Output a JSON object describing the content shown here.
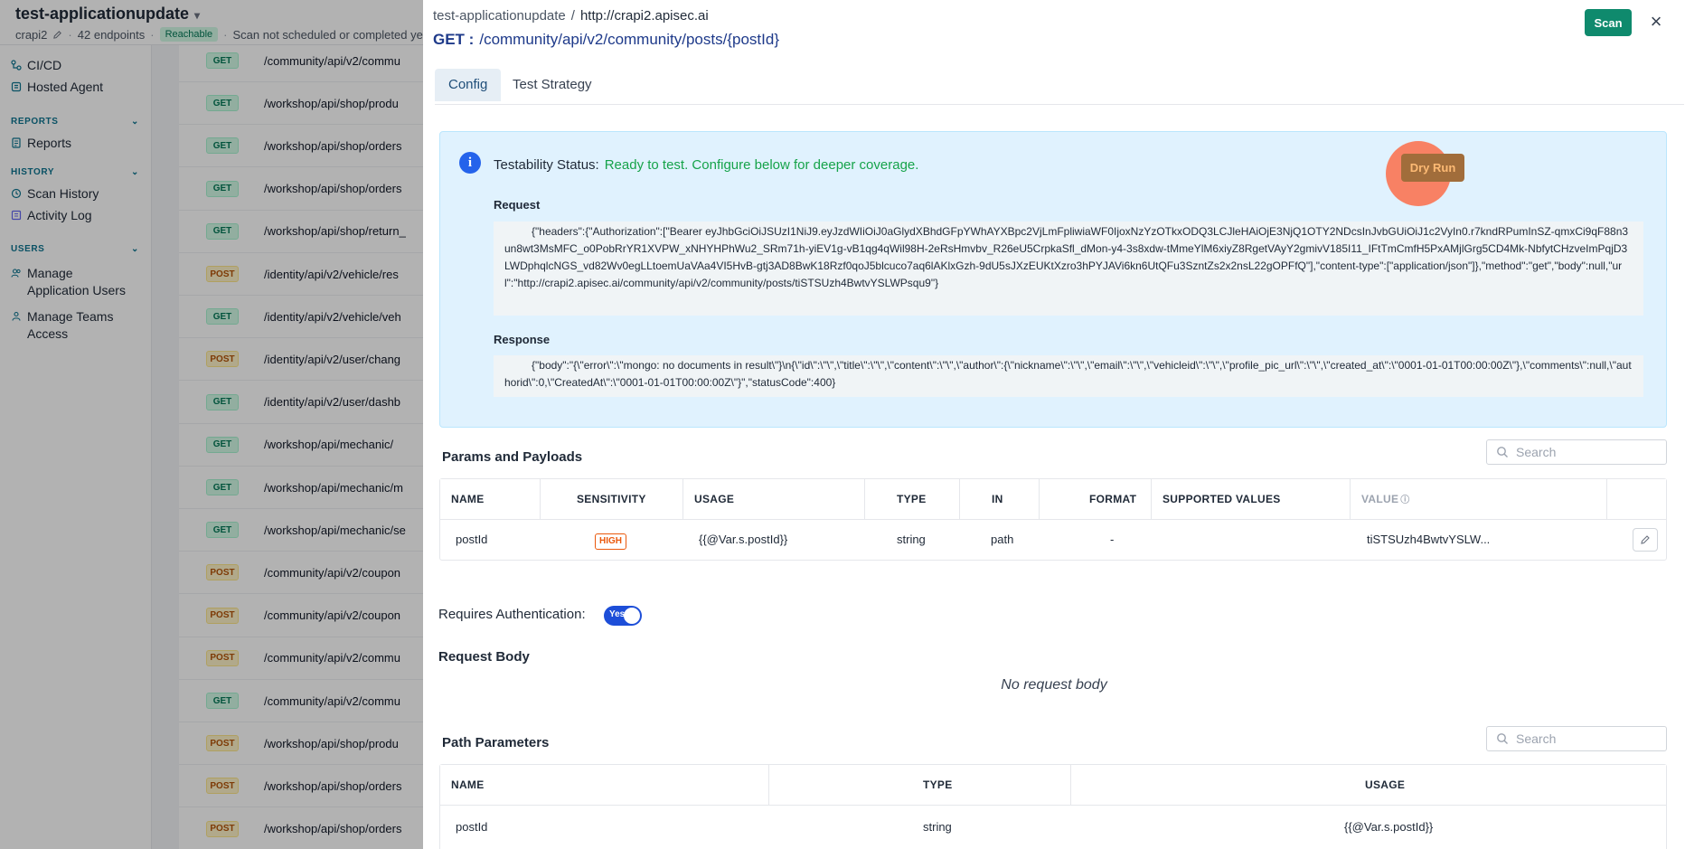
{
  "app": {
    "title": "test-applicationupdate",
    "project": "crapi2",
    "endpoints": "42 endpoints",
    "reachable": "Reachable",
    "scan_status": "Scan not scheduled or completed yet"
  },
  "sidebar": {
    "items": [
      {
        "label": "CI/CD",
        "icon": "cicd-icon"
      },
      {
        "label": "Hosted Agent",
        "icon": "agent-icon"
      }
    ],
    "sections": [
      {
        "label": "REPORTS",
        "items": [
          {
            "label": "Reports",
            "icon": "report-icon"
          }
        ]
      },
      {
        "label": "HISTORY",
        "items": [
          {
            "label": "Scan History",
            "icon": "history-icon"
          },
          {
            "label": "Activity Log",
            "icon": "log-icon"
          }
        ]
      },
      {
        "label": "USERS",
        "items": [
          {
            "label": "Manage Application Users",
            "icon": "users-icon"
          },
          {
            "label": "Manage Teams Access",
            "icon": "teams-icon"
          }
        ]
      }
    ]
  },
  "endpoint_list": [
    {
      "method": "GET",
      "path": "/community/api/v2/commu"
    },
    {
      "method": "GET",
      "path": "/workshop/api/shop/produ"
    },
    {
      "method": "GET",
      "path": "/workshop/api/shop/orders"
    },
    {
      "method": "GET",
      "path": "/workshop/api/shop/orders"
    },
    {
      "method": "GET",
      "path": "/workshop/api/shop/return_"
    },
    {
      "method": "POST",
      "path": "/identity/api/v2/vehicle/res"
    },
    {
      "method": "GET",
      "path": "/identity/api/v2/vehicle/veh"
    },
    {
      "method": "POST",
      "path": "/identity/api/v2/user/chang"
    },
    {
      "method": "GET",
      "path": "/identity/api/v2/user/dashb"
    },
    {
      "method": "GET",
      "path": "/workshop/api/mechanic/"
    },
    {
      "method": "GET",
      "path": "/workshop/api/mechanic/m"
    },
    {
      "method": "GET",
      "path": "/workshop/api/mechanic/se"
    },
    {
      "method": "POST",
      "path": "/community/api/v2/coupon"
    },
    {
      "method": "POST",
      "path": "/community/api/v2/coupon"
    },
    {
      "method": "POST",
      "path": "/community/api/v2/commu"
    },
    {
      "method": "GET",
      "path": "/community/api/v2/commu"
    },
    {
      "method": "POST",
      "path": "/workshop/api/shop/produ"
    },
    {
      "method": "POST",
      "path": "/workshop/api/shop/orders"
    },
    {
      "method": "POST",
      "path": "/workshop/api/shop/orders"
    }
  ],
  "drawer": {
    "breadcrumb_app": "test-applicationupdate",
    "breadcrumb_sep": "/",
    "breadcrumb_host": "http://crapi2.apisec.ai",
    "method": "GET :",
    "path": "/community/api/v2/community/posts/{postId}",
    "scan_label": "Scan",
    "close_label": "×",
    "tabs": [
      {
        "label": "Config",
        "active": true
      },
      {
        "label": "Test Strategy",
        "active": false
      }
    ],
    "testability_label": "Testability Status:",
    "testability_value": "Ready to test. Configure below for deeper coverage.",
    "dry_run_label": "Dry Run",
    "request_label": "Request",
    "request_body": "{\"headers\":{\"Authorization\":[\"Bearer eyJhbGciOiJSUzI1NiJ9.eyJzdWIiOiJ0aGlydXBhdGFpYWhAYXBpc2VjLmFpliwiaWF0IjoxNzYzOTkxODQ3LCJleHAiOjE3NjQ1OTY2NDcsInJvbGUiOiJ1c2VyIn0.r7kndRPumInSZ-qmxCi9qF88n3un8wt3MsMFC_o0PobRrYR1XVPW_xNHYHPhWu2_SRm71h-yiEV1g-vB1qg4qWil98H-2eRsHmvbv_R26eU5CrpkaSfl_dMon-y4-3s8xdw-tMmeYlM6xiyZ8RgetVAyY2gmivV185I11_IFtTmCmfH5PxAMjlGrg5CD4Mk-NbfytCHzveImPqjD3LWDphqlcNGS_vd82Wv0egLLtoemUaVAa4VI5HvB-gtj3AD8BwK18Rzf0qoJ5blcuco7aq6lAKlxGzh-9dU5sJXzEUKtXzro3hPYJAVi6kn6UtQFu3SzntZs2x2nsL22gOPFfQ\"],\"content-type\":[\"application/json\"]},\"method\":\"get\",\"body\":null,\"url\":\"http://crapi2.apisec.ai/community/api/v2/community/posts/tiSTSUzh4BwtvYSLWPsqu9\"}",
    "response_label": "Response",
    "response_body": "{\"body\":\"{\\\"error\\\":\\\"mongo: no documents in result\\\"}\\n{\\\"id\\\":\\\"\\\",\\\"title\\\":\\\"\\\",\\\"content\\\":\\\"\\\",\\\"author\\\":{\\\"nickname\\\":\\\"\\\",\\\"email\\\":\\\"\\\",\\\"vehicleid\\\":\\\"\\\",\\\"profile_pic_url\\\":\\\"\\\",\\\"created_at\\\":\\\"0001-01-01T00:00:00Z\\\"},\\\"comments\\\":null,\\\"authorid\\\":0,\\\"CreatedAt\\\":\\\"0001-01-01T00:00:00Z\\\"}\",\"statusCode\":400}",
    "params": {
      "title": "Params and Payloads",
      "search_placeholder": "Search",
      "columns": [
        "NAME",
        "SENSITIVITY",
        "USAGE",
        "TYPE",
        "IN",
        "FORMAT",
        "SUPPORTED VALUES",
        "VALUE"
      ],
      "rows": [
        {
          "name": "postId",
          "sensitivity": "HIGH",
          "usage": "{{@Var.s.postId}}",
          "type": "string",
          "in": "path",
          "format": "-",
          "supported": "",
          "value": "tiSTSUzh4BwtvYSLW..."
        }
      ]
    },
    "auth_label": "Requires Authentication:",
    "auth_toggle": "Yes",
    "request_body_title": "Request Body",
    "no_request_body": "No request body",
    "path_params": {
      "title": "Path Parameters",
      "search_placeholder": "Search",
      "columns": [
        "NAME",
        "TYPE",
        "USAGE"
      ],
      "rows": [
        {
          "name": "postId",
          "type": "string",
          "usage": "{{@Var.s.postId}}"
        }
      ]
    }
  },
  "colors": {
    "accent": "#0f8a6d",
    "link": "#1e3a8a",
    "ready": "#16a34a",
    "high": "#ea580c"
  }
}
